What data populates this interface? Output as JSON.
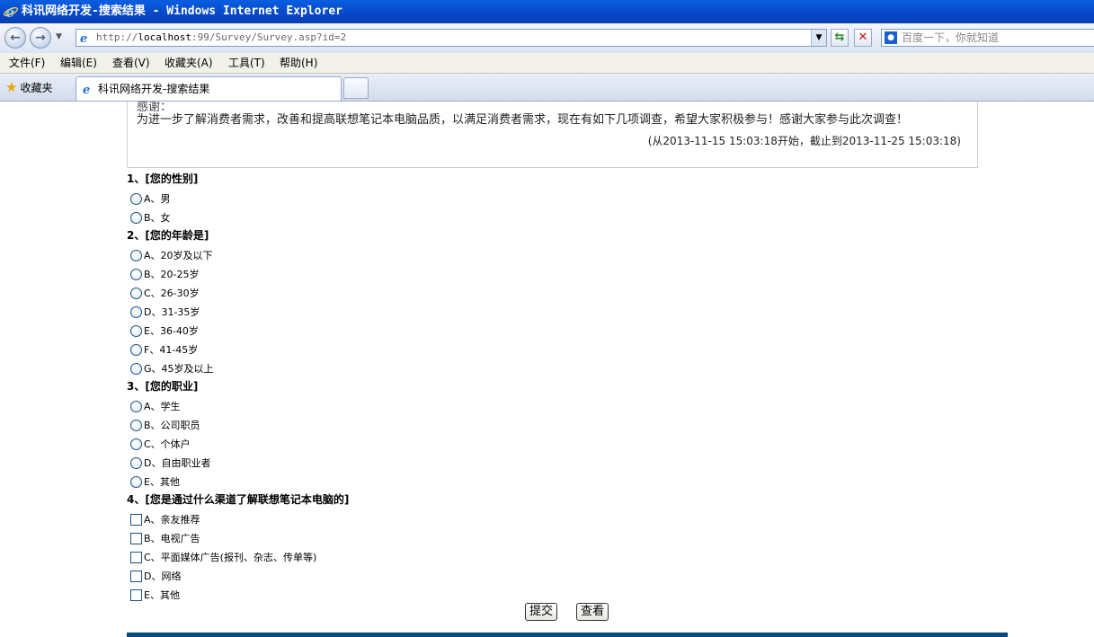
{
  "window": {
    "title": "科讯网络开发-搜索结果 - Windows Internet Explorer"
  },
  "address": {
    "url_prefix": "http://",
    "url_host": "localhost",
    "url_rest": ":99/Survey/Survey.asp?id=2"
  },
  "search": {
    "placeholder": "百度一下，你就知道"
  },
  "menu": [
    "文件(F)",
    "编辑(E)",
    "查看(V)",
    "收藏夹(A)",
    "工具(T)",
    "帮助(H)"
  ],
  "favorites_label": "收藏夹",
  "tab": {
    "label": "科讯网络开发-搜索结果"
  },
  "intro": {
    "cut_text": "感谢：",
    "text": "为进一步了解消费者需求，改善和提高联想笔记本电脑品质，以满足消费者需求，现在有如下几项调查，希望大家积极参与！感谢大家参与此次调查！",
    "period": "(从2013-11-15 15:03:18开始，截止到2013-11-25 15:03:18)"
  },
  "questions": [
    {
      "title": "1、[您的性别]",
      "type": "radio",
      "options": [
        "A、男",
        "B、女"
      ]
    },
    {
      "title": "2、[您的年龄是]",
      "type": "radio",
      "options": [
        "A、20岁及以下",
        "B、20-25岁",
        "C、26-30岁",
        "D、31-35岁",
        "E、36-40岁",
        "F、41-45岁",
        "G、45岁及以上"
      ]
    },
    {
      "title": "3、[您的职业]",
      "type": "radio",
      "options": [
        "A、学生",
        "B、公司职员",
        "C、个体户",
        "D、自由职业者",
        "E、其他"
      ]
    },
    {
      "title": "4、[您是通过什么渠道了解联想笔记本电脑的]",
      "type": "checkbox",
      "options": [
        "A、亲友推荐",
        "B、电视广告",
        "C、平面媒体广告(报刊、杂志、传单等)",
        "D、网络",
        "E、其他"
      ]
    }
  ],
  "buttons": {
    "submit": "提交",
    "view": "查看"
  },
  "colors": {
    "titlebar": "#0647c8",
    "footer": "#0b4a7e"
  }
}
